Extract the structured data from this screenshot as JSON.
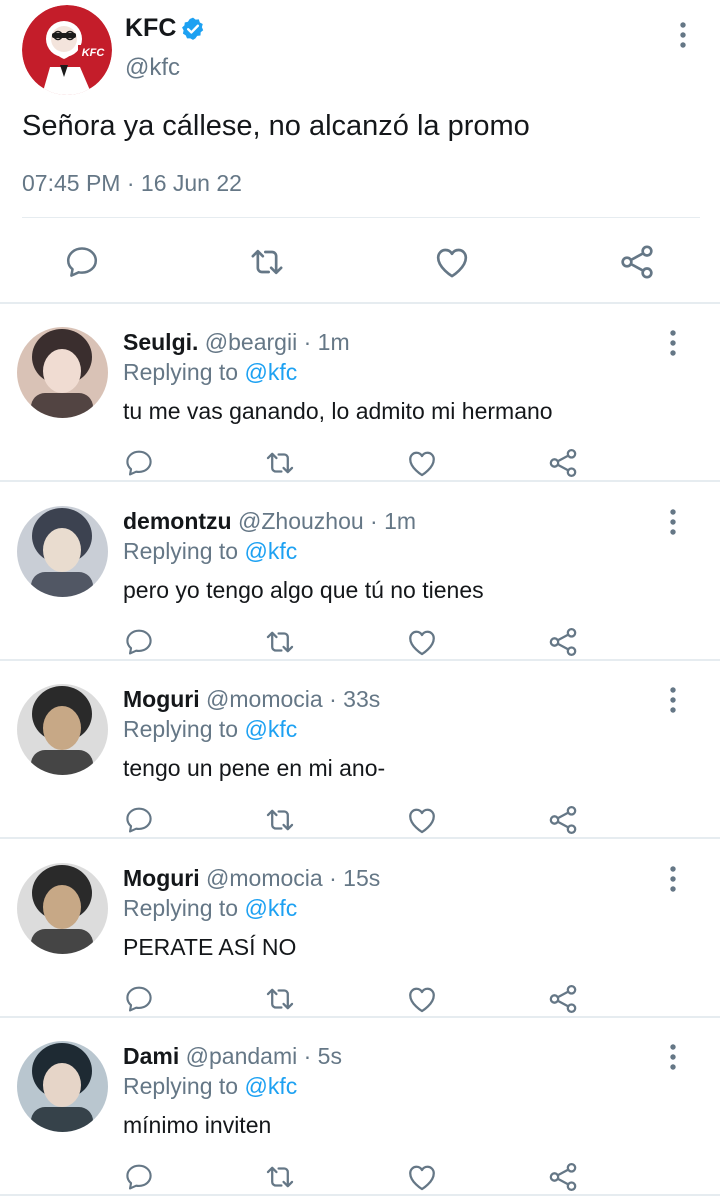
{
  "colors": {
    "text_primary": "#14171a",
    "text_secondary": "#657786",
    "link": "#1da1f2",
    "verified": "#1da1f2",
    "kfc_red": "#c41d2a",
    "divider": "#e6ecf0"
  },
  "main_tweet": {
    "author": {
      "name": "KFC",
      "handle": "@kfc",
      "verified": true,
      "avatar_logo_text": "KFC",
      "avatar_icon": "kfc-logo"
    },
    "text": "Señora ya cállese, no alcanzó la promo",
    "time": "07:45 PM",
    "separator": "·",
    "date": "16 Jun 22",
    "actions": [
      "reply-icon",
      "retweet-icon",
      "like-icon",
      "share-icon"
    ]
  },
  "replies": [
    {
      "name": "Seulgi.",
      "handle": "@beargii",
      "separator": "·",
      "time": "1m",
      "replying_label": "Replying to",
      "replying_to": "@kfc",
      "text": "tu me vas ganando, lo admito mi hermano",
      "avatar_palette": [
        "#d9c2b6",
        "#3a2e2e",
        "#f0dcd2"
      ]
    },
    {
      "name": "demontzu",
      "handle": "@Zhouzhou",
      "separator": "·",
      "time": "1m",
      "replying_label": "Replying to",
      "replying_to": "@kfc",
      "text": "pero yo tengo algo que tú no tienes",
      "avatar_palette": [
        "#c9ced6",
        "#3c4250",
        "#e9dccf"
      ]
    },
    {
      "name": "Moguri",
      "handle": "@momocia",
      "separator": "·",
      "time": "33s",
      "replying_label": "Replying to",
      "replying_to": "@kfc",
      "text": "tengo un pene en mi ano-",
      "avatar_palette": [
        "#dcdcdc",
        "#2a2a2a",
        "#c7a886"
      ]
    },
    {
      "name": "Moguri",
      "handle": "@momocia",
      "separator": "·",
      "time": "15s",
      "replying_label": "Replying to",
      "replying_to": "@kfc",
      "text": "PERATE ASÍ NO",
      "avatar_palette": [
        "#dcdcdc",
        "#2a2a2a",
        "#c7a886"
      ]
    },
    {
      "name": "Dami",
      "handle": "@pandami",
      "separator": "·",
      "time": "5s",
      "replying_label": "Replying to",
      "replying_to": "@kfc",
      "text": "mínimo inviten",
      "avatar_palette": [
        "#b9c6cf",
        "#1e2a33",
        "#e6d5c8"
      ]
    }
  ]
}
